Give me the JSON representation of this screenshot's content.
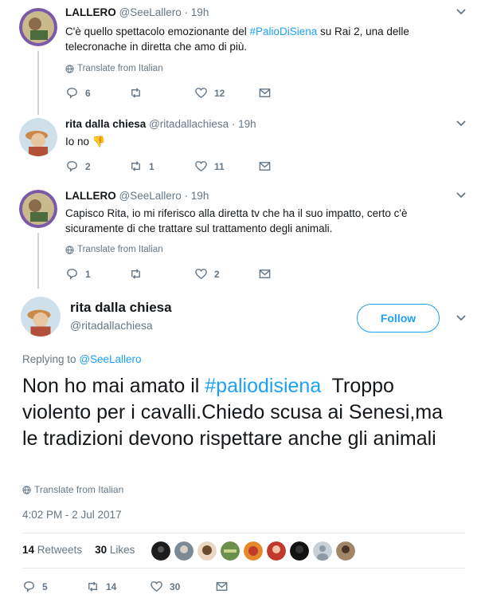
{
  "tweets": [
    {
      "name": "LALLERO",
      "handle": "@SeeLallero",
      "time": "19h",
      "text_before": "C'è quello spettacolo emozionante del ",
      "hashtag": "#PalioDiSiena",
      "text_after": " su Rai 2, una delle telecronache in diretta che amo di più.",
      "translate": "Translate from Italian",
      "replies": "6",
      "retweets": "",
      "likes": "12"
    },
    {
      "name": "rita dalla chiesa",
      "handle": "@ritadallachiesa",
      "time": "19h",
      "text": "Io no 👎",
      "replies": "2",
      "retweets": "1",
      "likes": "11"
    },
    {
      "name": "LALLERO",
      "handle": "@SeeLallero",
      "time": "19h",
      "text": "Capisco Rita, io mi riferisco alla diretta tv che ha il suo impatto, certo c'è sicuramente di che trattare sul trattamento degli animali.",
      "translate": "Translate from Italian",
      "replies": "1",
      "retweets": "",
      "likes": "2"
    }
  ],
  "main": {
    "name": "rita dalla chiesa",
    "handle": "@ritadallachiesa",
    "follow_label": "Follow",
    "replying_prefix": "Replying to",
    "replying_handle": "@SeeLallero",
    "text_before": "Non ho mai amato il ",
    "hashtag": "#paliodisiena",
    "text_after": "  Troppo violento per i cavalli.Chiedo scusa ai Senesi,ma le tradizioni devono rispettare anche gli animali",
    "translate": "Translate from Italian",
    "timestamp": "4:02 PM - 2 Jul 2017",
    "retweets_count": "14",
    "retweets_label": "Retweets",
    "likes_count": "30",
    "likes_label": "Likes",
    "replies": "5",
    "retweets": "14",
    "likes": "30"
  },
  "colors": {
    "accent": "#1da1f2",
    "muted": "#657786",
    "text": "#14171a",
    "thread_line": "#ccd6dd"
  },
  "icons": [
    "reply-icon",
    "retweet-icon",
    "heart-icon",
    "mail-icon",
    "globe-icon",
    "chevron-down-icon"
  ]
}
